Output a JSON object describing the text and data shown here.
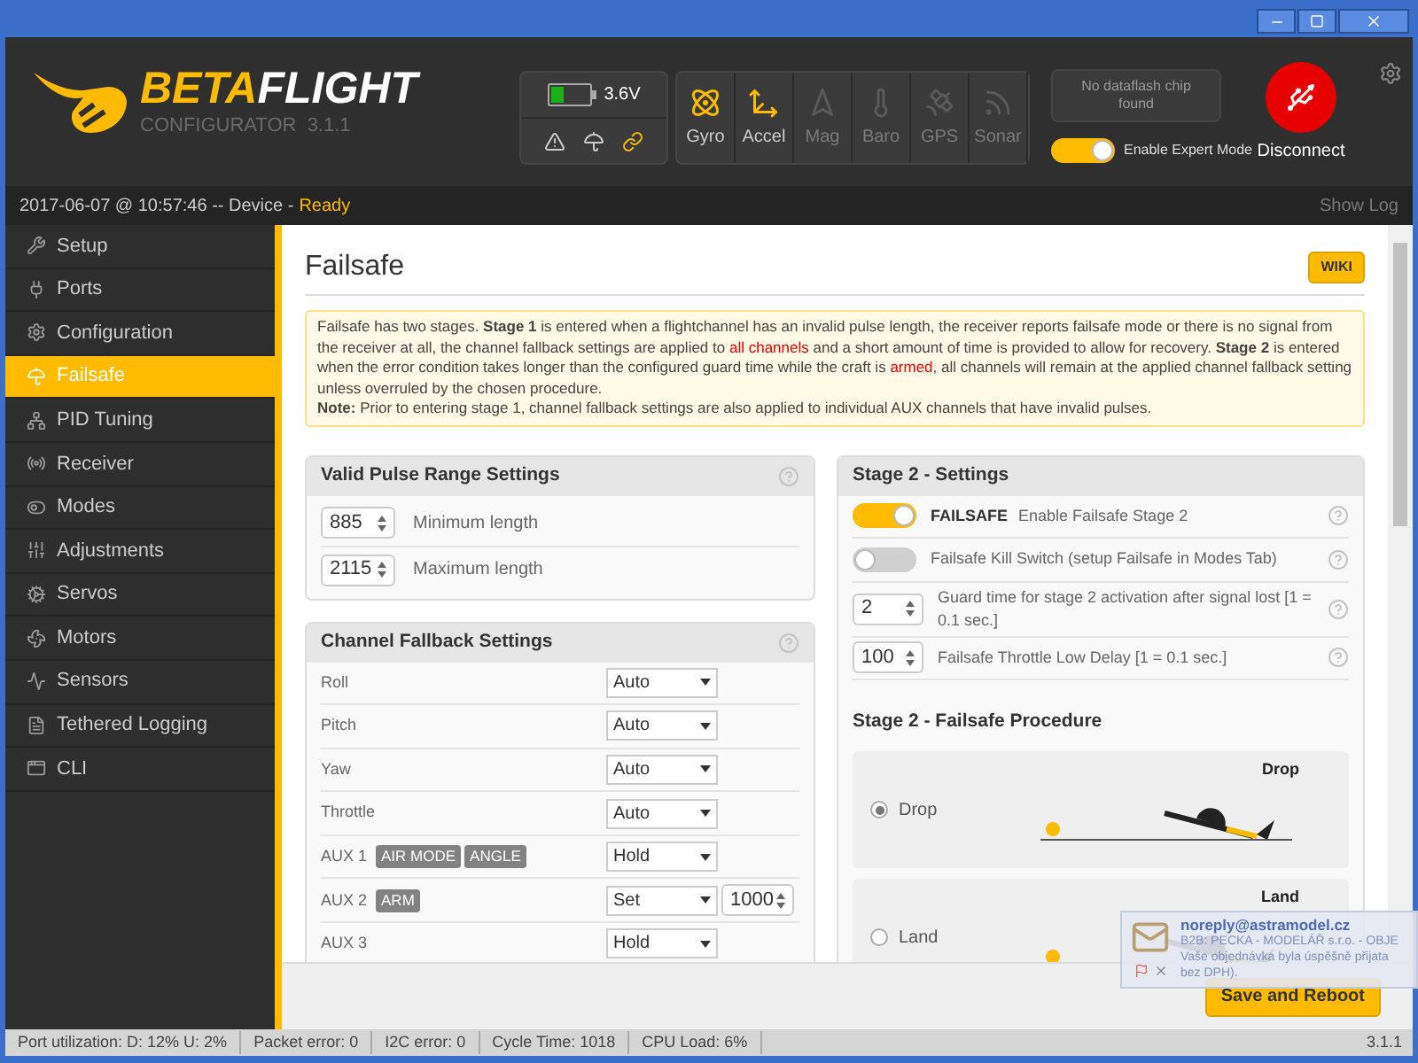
{
  "header": {
    "logo_primary": "BETA",
    "logo_secondary": "FLIGHT",
    "subtitle": "CONFIGURATOR  3.1.1",
    "voltage": "3.6V",
    "sensors": [
      {
        "label": "Gyro",
        "active": true
      },
      {
        "label": "Accel",
        "active": true
      },
      {
        "label": "Mag",
        "active": false
      },
      {
        "label": "Baro",
        "active": false
      },
      {
        "label": "GPS",
        "active": false
      },
      {
        "label": "Sonar",
        "active": false
      }
    ],
    "dataflash": "No dataflash chip found",
    "expert_mode": {
      "label": "Enable Expert Mode",
      "on": true
    },
    "connect": "Disconnect"
  },
  "status_line": {
    "timestamp": "2017-06-07 @ 10:57:46 -- Device -",
    "state": "Ready",
    "show_log": "Show Log"
  },
  "sidebar": {
    "items": [
      {
        "label": "Setup",
        "selected": false
      },
      {
        "label": "Ports",
        "selected": false
      },
      {
        "label": "Configuration",
        "selected": false
      },
      {
        "label": "Failsafe",
        "selected": true
      },
      {
        "label": "PID Tuning",
        "selected": false
      },
      {
        "label": "Receiver",
        "selected": false
      },
      {
        "label": "Modes",
        "selected": false
      },
      {
        "label": "Adjustments",
        "selected": false
      },
      {
        "label": "Servos",
        "selected": false
      },
      {
        "label": "Motors",
        "selected": false
      },
      {
        "label": "Sensors",
        "selected": false
      },
      {
        "label": "Tethered Logging",
        "selected": false
      },
      {
        "label": "CLI",
        "selected": false
      }
    ]
  },
  "page": {
    "title": "Failsafe",
    "wiki": "WIKI",
    "note": [
      [
        {
          "kind": "text",
          "text": "Failsafe has two stages. **Stage 1** is entered when a flightchannel has an invalid pulse length, the receiver reports failsafe mode or there is no signal from the receiver at all, the channel fallback settings are applied to "
        },
        {
          "kind": "alert",
          "text": "all channels"
        },
        {
          "kind": "text",
          "text": " and a short amount of time is provided to allow for recovery. **Stage 2** is entered when the error condition takes longer than the configured guard time while the craft is "
        },
        {
          "kind": "alert",
          "text": "armed"
        },
        {
          "kind": "text",
          "text": ", all channels will remain at the applied channel fallback setting unless overruled by the chosen procedure."
        }
      ],
      [
        {
          "kind": "text",
          "text": "**Note:** Prior to entering stage 1, channel fallback settings are also applied to individual AUX channels that have invalid pulses."
        }
      ]
    ],
    "pulse_range": {
      "title": "Valid Pulse Range Settings",
      "rows": [
        {
          "value": "885",
          "label": "Minimum length"
        },
        {
          "value": "2115",
          "label": "Maximum length"
        }
      ]
    },
    "fallback": {
      "title": "Channel Fallback Settings",
      "rows": [
        {
          "label": "Roll",
          "badges": [],
          "mode": "Auto"
        },
        {
          "label": "Pitch",
          "badges": [],
          "mode": "Auto"
        },
        {
          "label": "Yaw",
          "badges": [],
          "mode": "Auto"
        },
        {
          "label": "Throttle",
          "badges": [],
          "mode": "Auto"
        },
        {
          "label": "AUX 1",
          "badges": [
            "AIR MODE",
            "ANGLE"
          ],
          "mode": "Hold"
        },
        {
          "label": "AUX 2",
          "badges": [
            "ARM"
          ],
          "mode": "Set",
          "value": "1000"
        },
        {
          "label": "AUX 3",
          "badges": [],
          "mode": "Hold"
        }
      ]
    },
    "stage2": {
      "title": "Stage 2 - Settings",
      "rows": [
        {
          "kind": "switch",
          "on": true,
          "tag": "FAILSAFE",
          "label": "Enable Failsafe Stage 2"
        },
        {
          "kind": "switch",
          "on": false,
          "label": "Failsafe Kill Switch (setup Failsafe in Modes Tab)"
        },
        {
          "kind": "number",
          "value": "2",
          "label": "Guard time for stage 2 activation after signal lost [1 = 0.1 sec.]"
        },
        {
          "kind": "number",
          "value": "100",
          "label": "Failsafe Throttle Low Delay [1 = 0.1 sec.]"
        }
      ]
    },
    "procedure": {
      "title": "Stage 2 - Failsafe Procedure",
      "options": [
        {
          "label": "Drop",
          "caption": "Drop",
          "selected": true
        },
        {
          "label": "Land",
          "caption": "Land",
          "selected": false
        }
      ]
    },
    "save": "Save and Reboot"
  },
  "notification": {
    "sender": "noreply@astramodel.cz",
    "lines": [
      "B2B: PECKA - MODELÁŘ s.r.o. - OBJE",
      "Vaše objednávka byla úspěšně přijata",
      "bez DPH)."
    ]
  },
  "status_bar": {
    "items": [
      "Port utilization: D: 12% U: 2%",
      "Packet error: 0",
      "I2C error: 0",
      "Cycle Time: 1018",
      "CPU Load: 6%"
    ],
    "version": "3.1.1"
  }
}
